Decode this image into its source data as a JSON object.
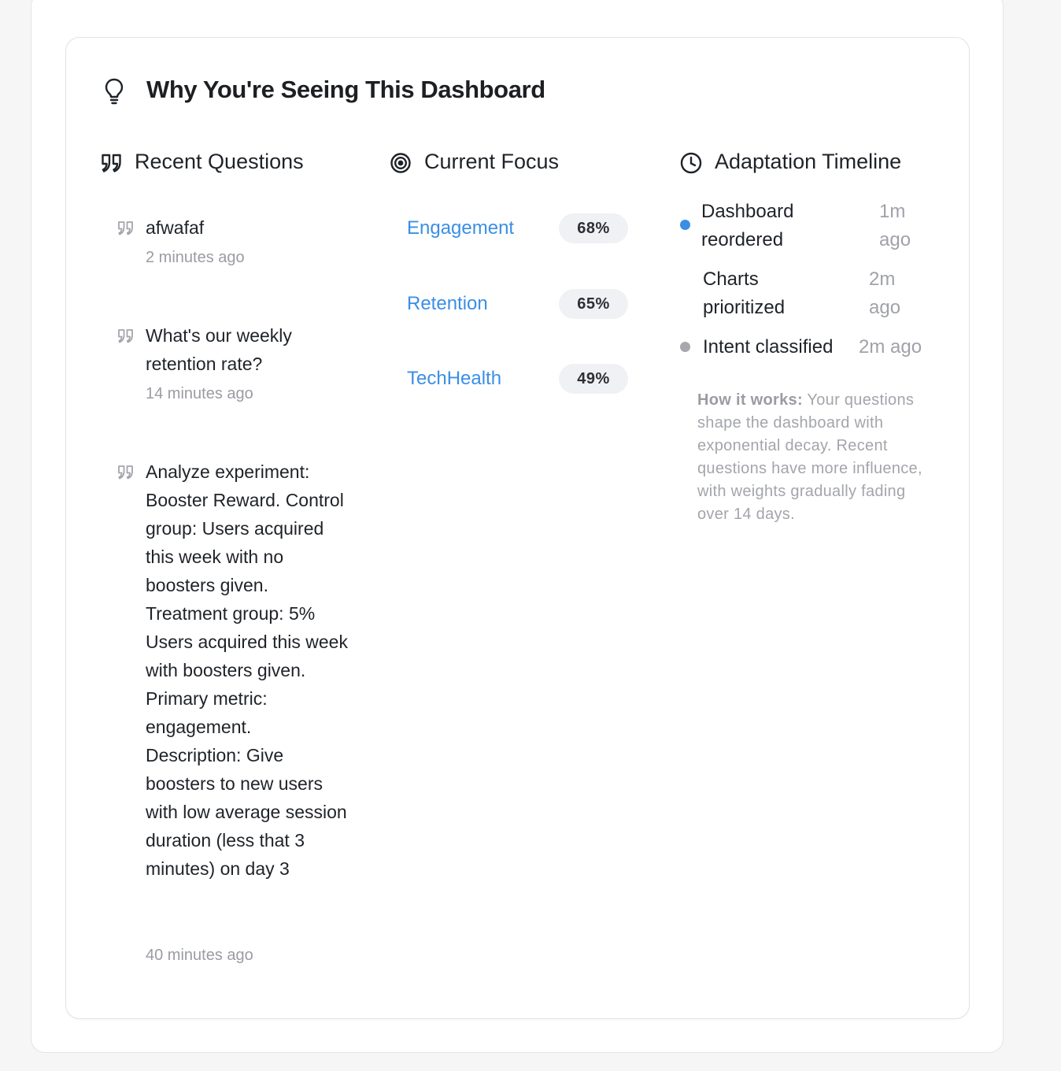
{
  "panel": {
    "title": "Why You're Seeing This Dashboard",
    "icon": "lightbulb-icon"
  },
  "recent_questions": {
    "title": "Recent Questions",
    "icon": "quote-icon",
    "items": [
      {
        "text": "afwafaf",
        "time": "2 minutes ago"
      },
      {
        "text": "What's our weekly retention rate?",
        "time": "14 minutes ago"
      },
      {
        "text": "Analyze experiment: Booster Reward. Control group: Users acquired this week with no boosters given. Treatment group: 5% Users acquired this week with boosters given. Primary metric: engagement. Description: Give boosters to new users with low average session duration (less that 3 minutes) on day 3",
        "time": "40 minutes ago"
      }
    ]
  },
  "current_focus": {
    "title": "Current Focus",
    "icon": "target-icon",
    "items": [
      {
        "label": "Engagement",
        "percent": "68%"
      },
      {
        "label": "Retention",
        "percent": "65%"
      },
      {
        "label": "TechHealth",
        "percent": "49%"
      }
    ],
    "accent_color": "#3b8ee6"
  },
  "adaptation_timeline": {
    "title": "Adaptation Timeline",
    "icon": "clock-icon",
    "events": [
      {
        "label": "Dashboard reordered",
        "time": "1m ago",
        "dot_color": "#3b8ee6"
      },
      {
        "label": "Charts prioritized",
        "time": "2m ago",
        "dot_color": ""
      },
      {
        "label": "Intent classified",
        "time": "2m ago",
        "dot_color": "#a6a8ae"
      }
    ],
    "how_it_works_label": "How it works:",
    "how_it_works_text": "Your questions shape the dashboard with exponential decay. Recent questions have more influence, with weights gradually fading over 14 days."
  }
}
